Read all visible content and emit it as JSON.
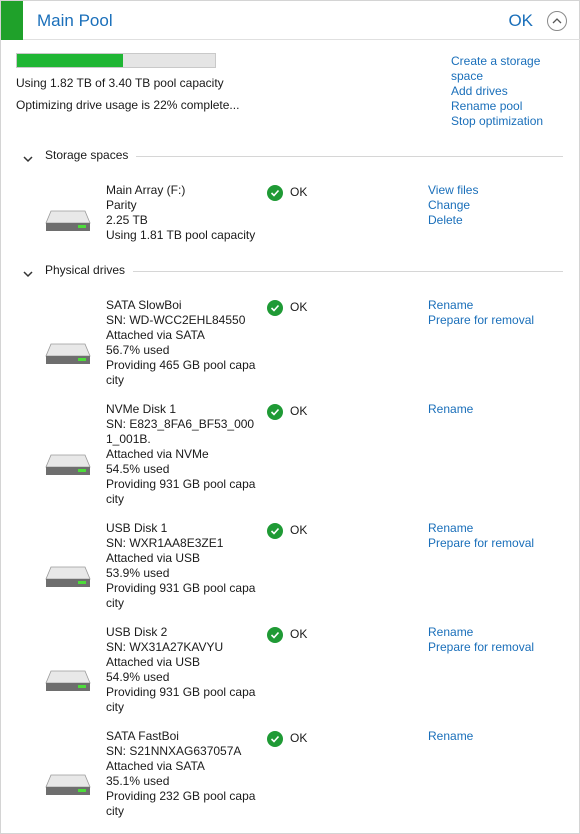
{
  "header": {
    "title": "Main Pool",
    "status": "OK",
    "collapse_icon": "chevron-up-circle-icon",
    "accent_color": "#1fa12a"
  },
  "pool": {
    "usage_fraction": 0.535,
    "usage_text": "Using 1.82 TB of 3.40 TB pool capacity",
    "optimizing_text": "Optimizing drive usage is 22% complete...",
    "bar_color": "#1fb634",
    "actions": [
      "Create a storage space",
      "Add drives",
      "Rename pool",
      "Stop optimization"
    ]
  },
  "storage_spaces": {
    "title": "Storage spaces",
    "items": [
      {
        "lines": [
          "Main Array (F:)",
          "Parity",
          "2.25 TB",
          "Using 1.81 TB pool capacity"
        ],
        "status": "OK",
        "actions": [
          "View files",
          "Change",
          "Delete"
        ]
      }
    ]
  },
  "physical_drives": {
    "title": "Physical drives",
    "items": [
      {
        "lines": [
          "SATA SlowBoi",
          "SN: WD-WCC2EHL84550",
          "Attached via SATA",
          "56.7% used",
          "Providing 465 GB pool capacity"
        ],
        "status": "OK",
        "actions": [
          "Rename",
          "Prepare for removal"
        ]
      },
      {
        "lines": [
          "NVMe Disk 1",
          "SN: E823_8FA6_BF53_0001_001B.",
          "Attached via NVMe",
          "54.5% used",
          "Providing 931 GB pool capacity"
        ],
        "status": "OK",
        "actions": [
          "Rename"
        ]
      },
      {
        "lines": [
          "USB Disk 1",
          "SN: WXR1AA8E3ZE1",
          "Attached via USB",
          "53.9% used",
          "Providing 931 GB pool capacity"
        ],
        "status": "OK",
        "actions": [
          "Rename",
          "Prepare for removal"
        ]
      },
      {
        "lines": [
          "USB Disk 2",
          "SN: WX31A27KAVYU",
          "Attached via USB",
          "54.9% used",
          "Providing 931 GB pool capacity"
        ],
        "status": "OK",
        "actions": [
          "Rename",
          "Prepare for removal"
        ]
      },
      {
        "lines": [
          "SATA FastBoi",
          "SN: S21NNXAG637057A",
          "Attached via SATA",
          "35.1% used",
          "Providing 232 GB pool capacity"
        ],
        "status": "OK",
        "actions": [
          "Rename"
        ]
      }
    ]
  },
  "icons": {
    "section_toggle": "chevron-down-icon",
    "drive": "hard-drive-icon",
    "status": "ok-check-icon"
  }
}
